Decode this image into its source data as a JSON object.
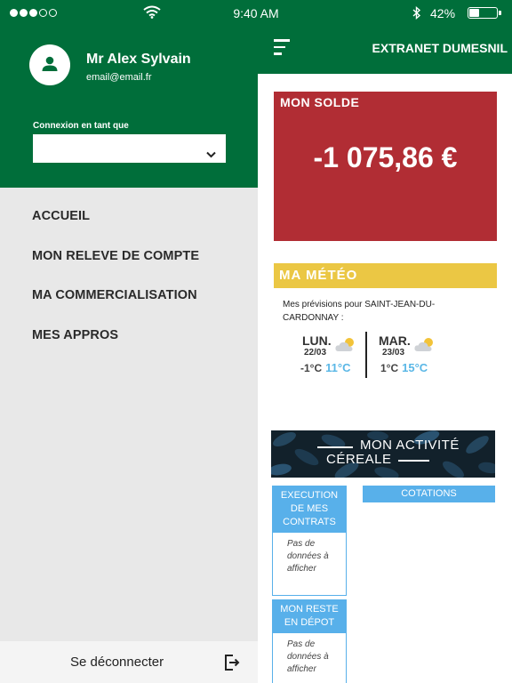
{
  "status_bar": {
    "time": "9:40 AM",
    "battery_percent_text": "42%",
    "battery_level": 0.42,
    "signal_bars_filled": 3,
    "signal_bars_total": 5,
    "wifi_icon": "wifi-icon",
    "bluetooth_icon": "bluetooth-icon"
  },
  "drawer": {
    "user_name": "Mr Alex Sylvain",
    "user_email": "email@email.fr",
    "connection_label": "Connexion en tant que",
    "connection_value": "",
    "menu_items": [
      {
        "label": "ACCUEIL"
      },
      {
        "label": "MON RELEVE DE COMPTE"
      },
      {
        "label": "MA COMMERCIALISATION"
      },
      {
        "label": "MES APPROS"
      }
    ],
    "logout_label": "Se déconnecter"
  },
  "header": {
    "title": "EXTRANET DUMESNIL"
  },
  "solde": {
    "title": "MON SOLDE",
    "amount": "-1 075,86 €"
  },
  "meteo": {
    "title": "MA MÉTÉO",
    "description": "Mes prévisions pour SAINT-JEAN-DU-CARDONNAY :",
    "days": [
      {
        "name": "LUN.",
        "date": "22/03",
        "min": "-1°C",
        "max": "11°C",
        "icon": "cloud-sun-icon"
      },
      {
        "name": "MAR.",
        "date": "23/03",
        "min": "1°C",
        "max": "15°C",
        "icon": "cloud-sun-icon"
      }
    ]
  },
  "activite": {
    "title_line1": "MON ACTIVITÉ",
    "title_line2": "CÉREALE",
    "cards": [
      {
        "title": "EXECUTION DE MES CONTRATS",
        "empty": "Pas de données à afficher"
      },
      {
        "title": "MON RESTE EN DÉPOT",
        "empty": "Pas de données à afficher"
      }
    ],
    "cotations_label": "COTATIONS"
  },
  "colors": {
    "brand_green": "#006e3a",
    "solde_red": "#b12d34",
    "meteo_yellow": "#ebc744",
    "accent_blue": "#58b0ea"
  }
}
